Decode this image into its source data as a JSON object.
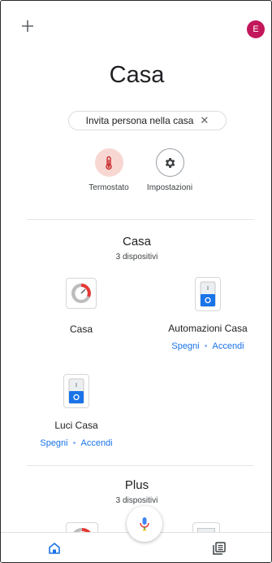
{
  "header": {
    "add_icon": "plus-icon",
    "avatar_initial": "E",
    "avatar_color": "#c2185b"
  },
  "home": {
    "title": "Casa",
    "invite_chip": "Invita persona nella casa",
    "invite_chip_close": "✕"
  },
  "quick_actions": [
    {
      "label": "Termostato",
      "icon": "thermometer-icon"
    },
    {
      "label": "Impostazioni",
      "icon": "gear-icon"
    }
  ],
  "rooms": [
    {
      "title": "Casa",
      "subtitle": "3 dispositivi",
      "devices": [
        {
          "name": "Casa",
          "icon": "thermostat-gauge-icon"
        },
        {
          "name": "Automazioni Casa",
          "icon": "switch-icon",
          "off_label": "Spegni",
          "on_label": "Accendi"
        },
        {
          "name": "Luci Casa",
          "icon": "switch-icon",
          "off_label": "Spegni",
          "on_label": "Accendi"
        }
      ]
    },
    {
      "title": "Plus",
      "subtitle": "3 dispositivi"
    }
  ],
  "fab": {
    "icon": "microphone-icon"
  },
  "bottom_nav": [
    {
      "icon": "home-icon",
      "active": true
    },
    {
      "icon": "feed-icon",
      "active": false
    }
  ],
  "colors": {
    "accent_blue": "#1a73e8",
    "thermostat_bg": "#f8d7d3",
    "thermostat_red": "#e53935"
  }
}
